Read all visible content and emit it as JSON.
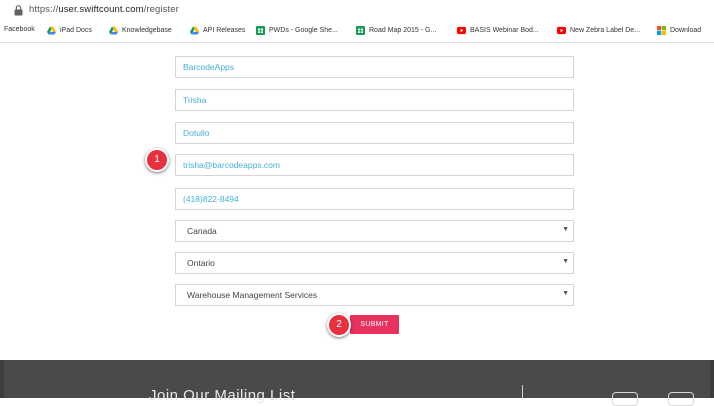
{
  "browser": {
    "url_prefix": "https://",
    "url_domain": "user.swiftcount.com",
    "url_path": "/register"
  },
  "bookmarks": [
    {
      "label": "Facebook",
      "icon": "none"
    },
    {
      "label": "iPad Docs",
      "icon": "drive-icon"
    },
    {
      "label": "Knowledgebase",
      "icon": "drive-icon"
    },
    {
      "label": "API Releases",
      "icon": "drive-icon"
    },
    {
      "label": "PWDs - Google She...",
      "icon": "sheets-icon"
    },
    {
      "label": "Road Map 2015 - G...",
      "icon": "sheets-icon"
    },
    {
      "label": "BASIS Webinar Bod...",
      "icon": "youtube-icon"
    },
    {
      "label": "New Zebra Label De...",
      "icon": "youtube-icon"
    },
    {
      "label": "Download",
      "icon": "microsoft-icon"
    }
  ],
  "form": {
    "company": "BarcodeApps",
    "first_name": "Trisha",
    "last_name": "Dotullo",
    "email": "trisha@barcodeapps.com",
    "phone": "(418)822-8494",
    "country": "Canada",
    "province": "Ontario",
    "industry": "Warehouse Management Services",
    "submit_label": "SUBMIT"
  },
  "annotations": {
    "badge1": "1",
    "badge2": "2"
  },
  "footer": {
    "mailing_list": "Join Our Mailing List"
  },
  "colors": {
    "accent": "#e8315d",
    "badge": "#e8313f",
    "input_text": "#45b0d6",
    "footer_bg": "#4a4a4a"
  }
}
